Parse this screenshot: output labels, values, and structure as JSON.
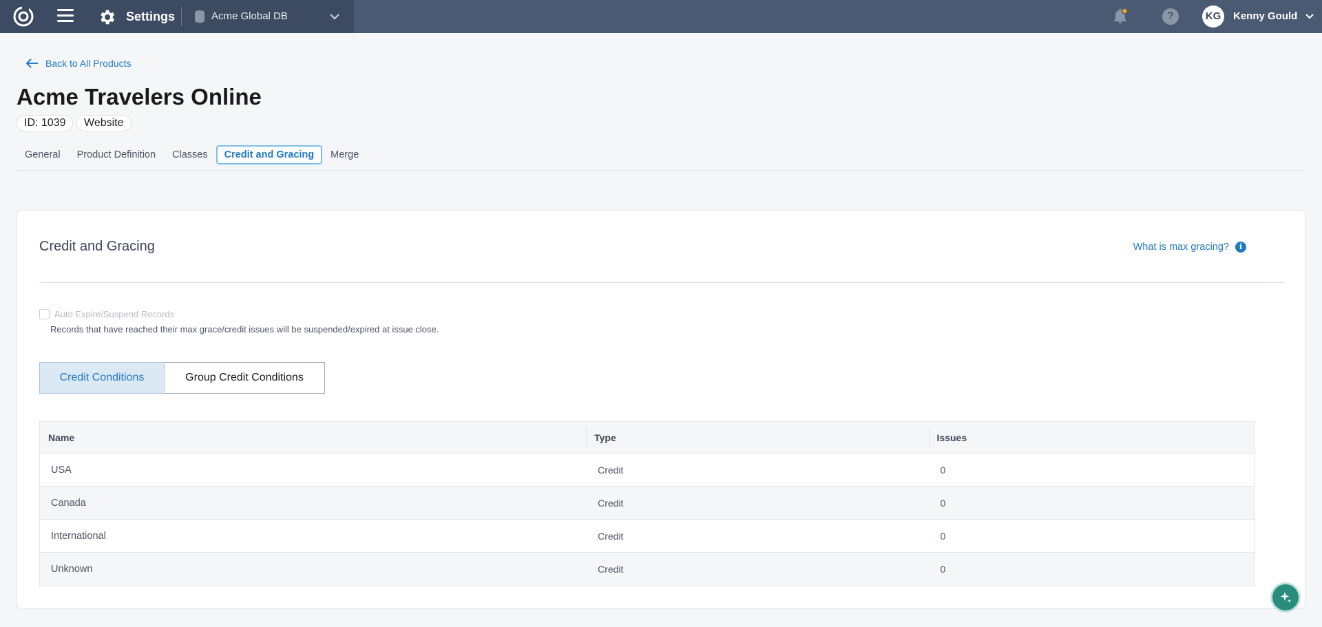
{
  "topbar": {
    "section_title": "Settings",
    "database_name": "Acme Global DB",
    "user_initials": "KG",
    "user_name": "Kenny Gould",
    "help_glyph": "?",
    "notification_dot_color": "#f0a020"
  },
  "header": {
    "back_link": "Back to All Products",
    "title": "Acme Travelers Online",
    "id_badge": "ID: 1039",
    "type_badge": "Website"
  },
  "tabs": [
    {
      "label": "General",
      "active": false
    },
    {
      "label": "Product Definition",
      "active": false
    },
    {
      "label": "Classes",
      "active": false
    },
    {
      "label": "Credit and Gracing",
      "active": true
    },
    {
      "label": "Merge",
      "active": false
    }
  ],
  "card": {
    "title": "Credit and Gracing",
    "help_link": "What is max gracing?",
    "info_glyph": "i",
    "checkbox_label": "Auto Expire/Suspend Records",
    "checkbox_checked": false,
    "checkbox_help": "Records that have reached their max grace/credit issues will be suspended/expired at issue close.",
    "segments": [
      {
        "label": "Credit Conditions",
        "active": true
      },
      {
        "label": "Group Credit Conditions",
        "active": false
      }
    ]
  },
  "table": {
    "columns": [
      "Name",
      "Type",
      "Issues"
    ],
    "rows": [
      {
        "name": "USA",
        "type": "Credit",
        "issues": "0"
      },
      {
        "name": "Canada",
        "type": "Credit",
        "issues": "0"
      },
      {
        "name": "International",
        "type": "Credit",
        "issues": "0"
      },
      {
        "name": "Unknown",
        "type": "Credit",
        "issues": "0"
      }
    ]
  },
  "colors": {
    "topbar": "#4a5a73",
    "topbar_left": "#3c4b62",
    "accent": "#2279c4",
    "fab": "#2a8c7d"
  },
  "icons": [
    "app-logo-icon",
    "hamburger-menu-icon",
    "gear-icon",
    "database-icon",
    "chevron-down-icon",
    "bell-icon",
    "help-icon",
    "arrow-left-icon",
    "info-icon",
    "sparkle-icon"
  ]
}
